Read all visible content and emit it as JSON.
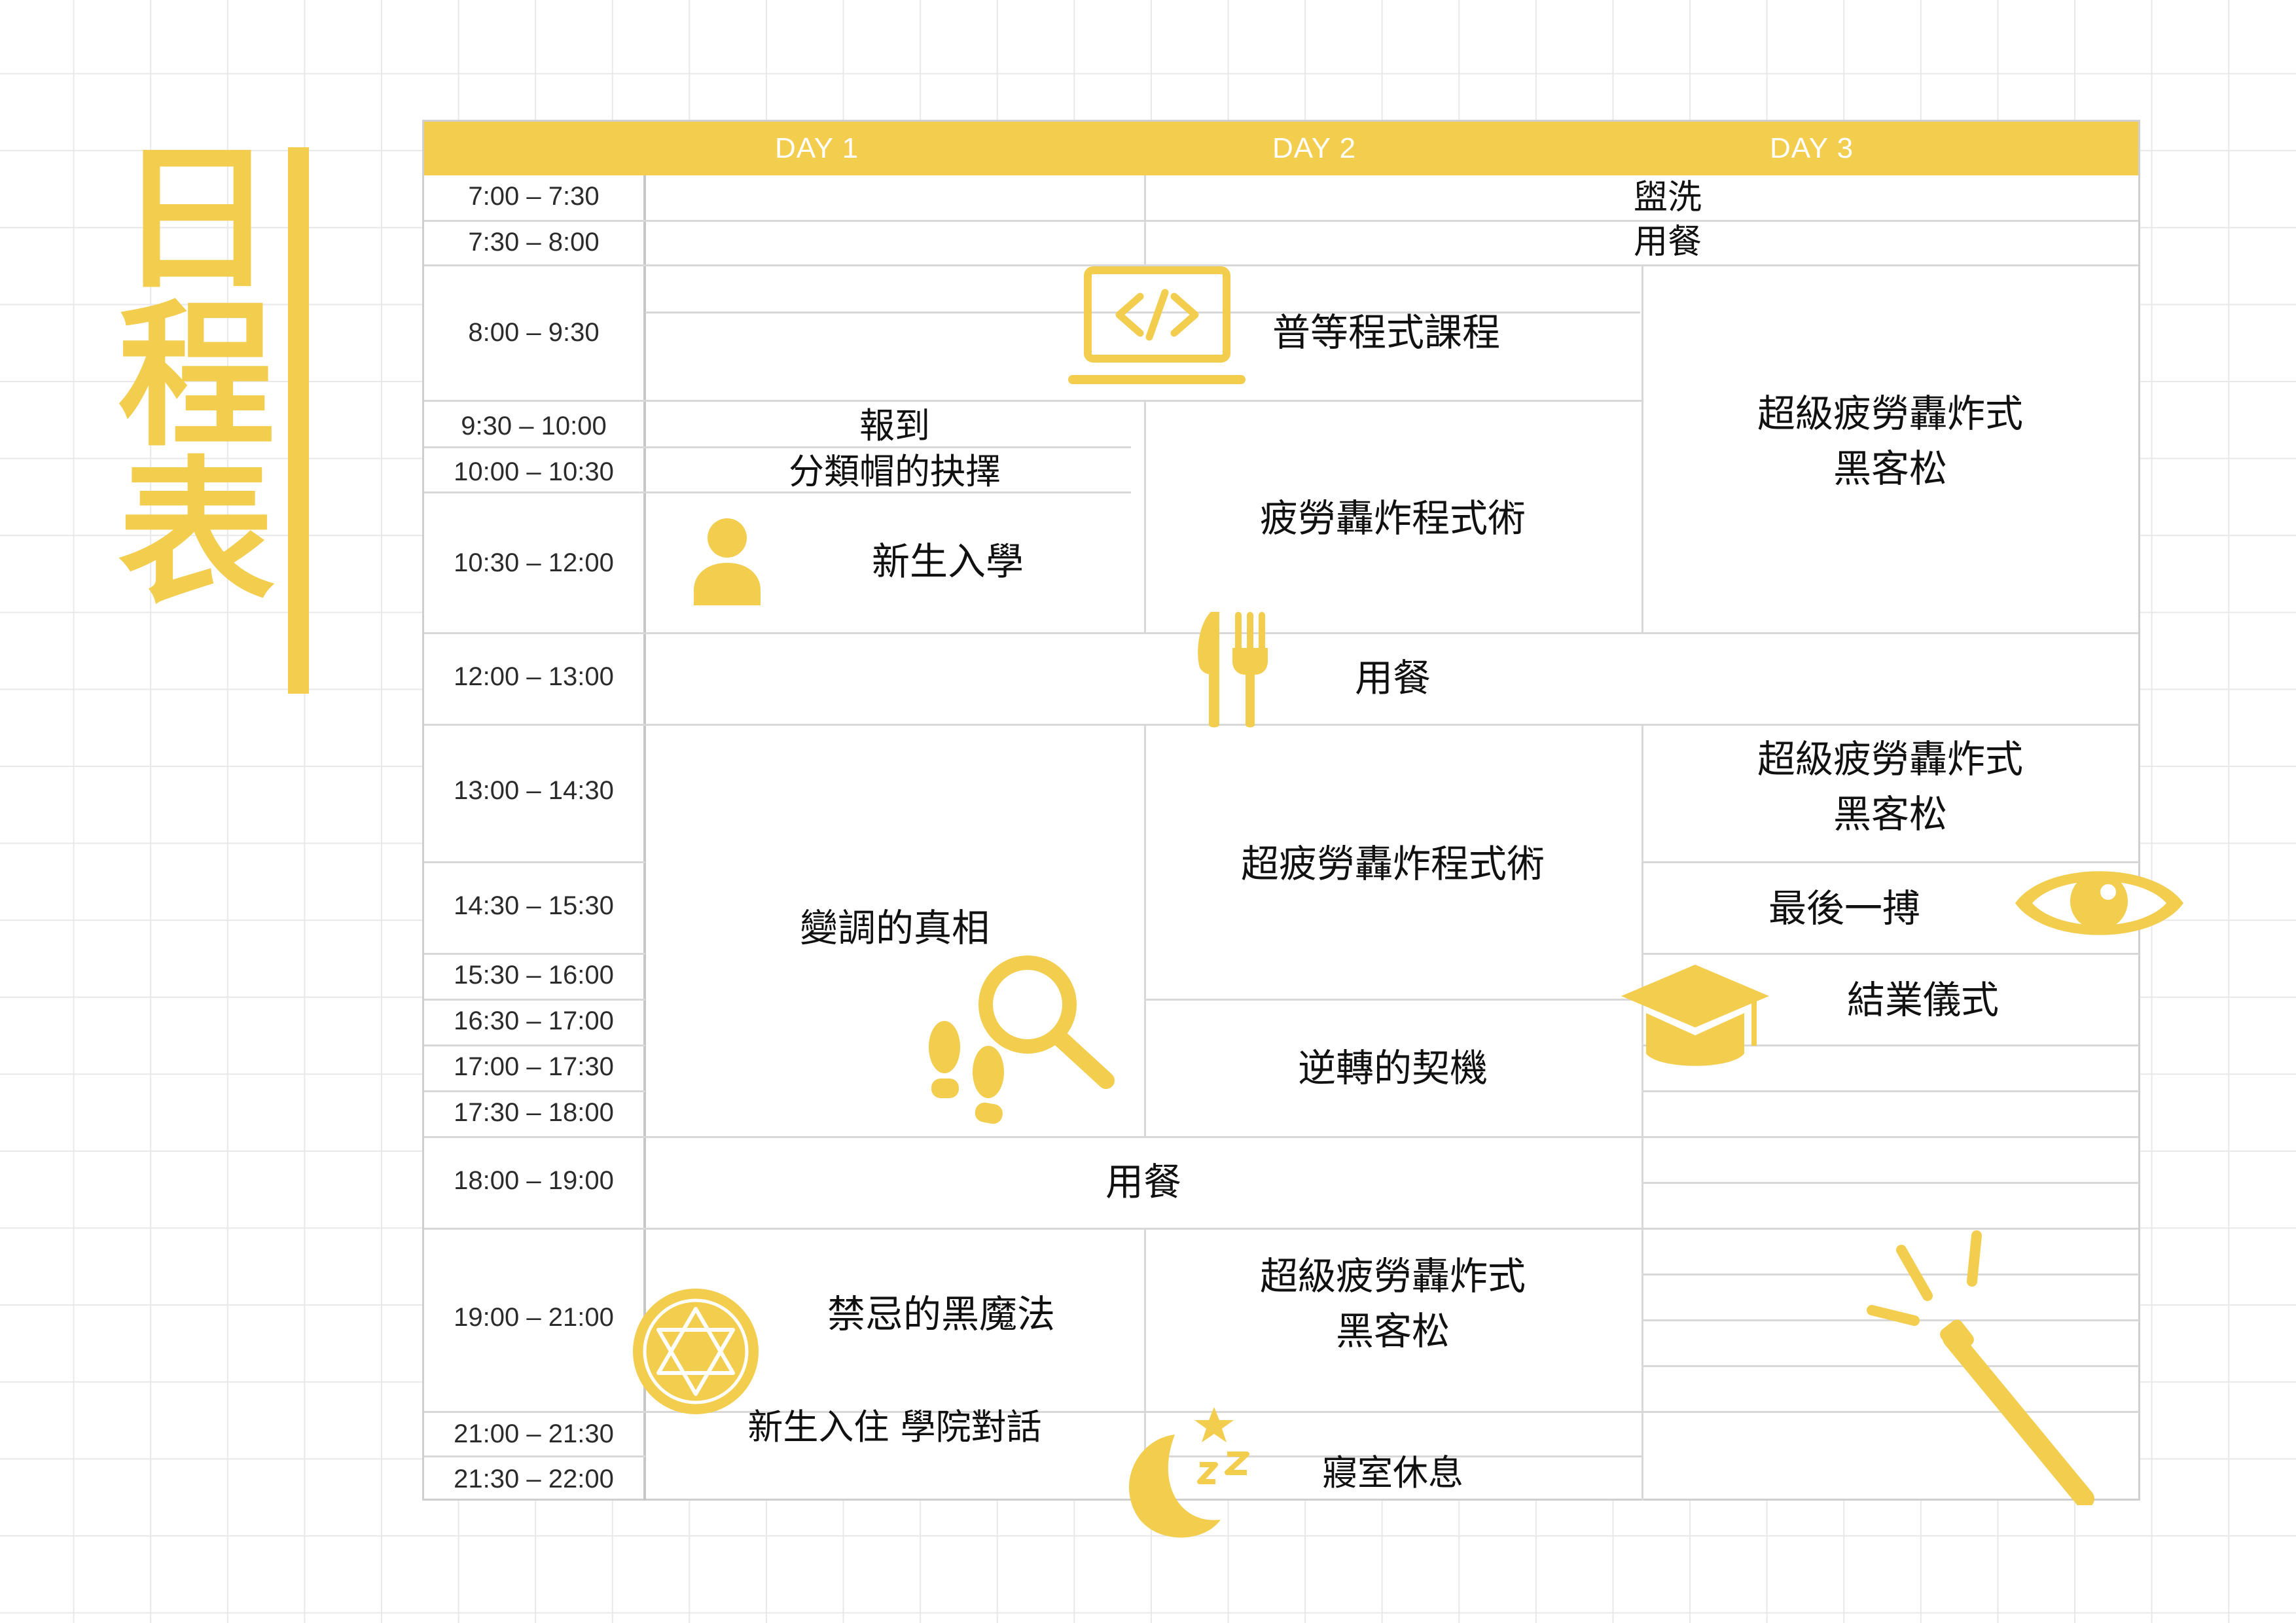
{
  "title": "日程表",
  "days": [
    "DAY 1",
    "DAY 2",
    "DAY 3"
  ],
  "times": [
    "7:00 – 7:30",
    "7:30 – 8:00",
    "8:00 – 9:30",
    "9:30 – 10:00",
    "10:00 – 10:30",
    "10:30 – 12:00",
    "12:00 – 13:00",
    "13:00 – 14:30",
    "14:30 – 15:30",
    "15:30 – 16:00",
    "16:30 – 17:00",
    "17:00 – 17:30",
    "17:30 – 18:00",
    "18:00 – 19:00",
    "19:00 – 21:00",
    "21:00 – 21:30",
    "21:30 – 22:00"
  ],
  "events": {
    "wash": "盥洗",
    "breakfast": "用餐",
    "course": "普等程式課程",
    "day3_hackathon1": "超級疲勞轟炸式\n黑客松",
    "checkin": "報到",
    "sorting_hat": "分類帽的抉擇",
    "day2_fatigue": "疲勞轟炸程式術",
    "new_student": "新生入學",
    "lunch": "用餐",
    "day3_hackathon2": "超級疲勞轟炸式\n黑客松",
    "day2_super_fatigue": "超疲勞轟炸程式術",
    "final_fight": "最後一搏",
    "truth": "變調的真相",
    "closing": "結業儀式",
    "turnaround": "逆轉的契機",
    "dinner": "用餐",
    "dark_magic": "禁忌的黑魔法",
    "day2_hackathon": "超級疲勞轟炸式\n黑客松",
    "dorm_talk": "新生入住 學院對話",
    "rest": "寢室休息"
  },
  "colors": {
    "accent": "#f2cd4e",
    "grid": "#e8e8e8",
    "table_border": "#cfcfcf"
  },
  "icons": [
    "laptop-code-icon",
    "person-icon",
    "fork-knife-icon",
    "eye-icon",
    "magnifier-icon",
    "footprints-icon",
    "graduation-cap-icon",
    "star-of-david-icon",
    "moon-sleep-icon",
    "magic-wand-icon"
  ]
}
